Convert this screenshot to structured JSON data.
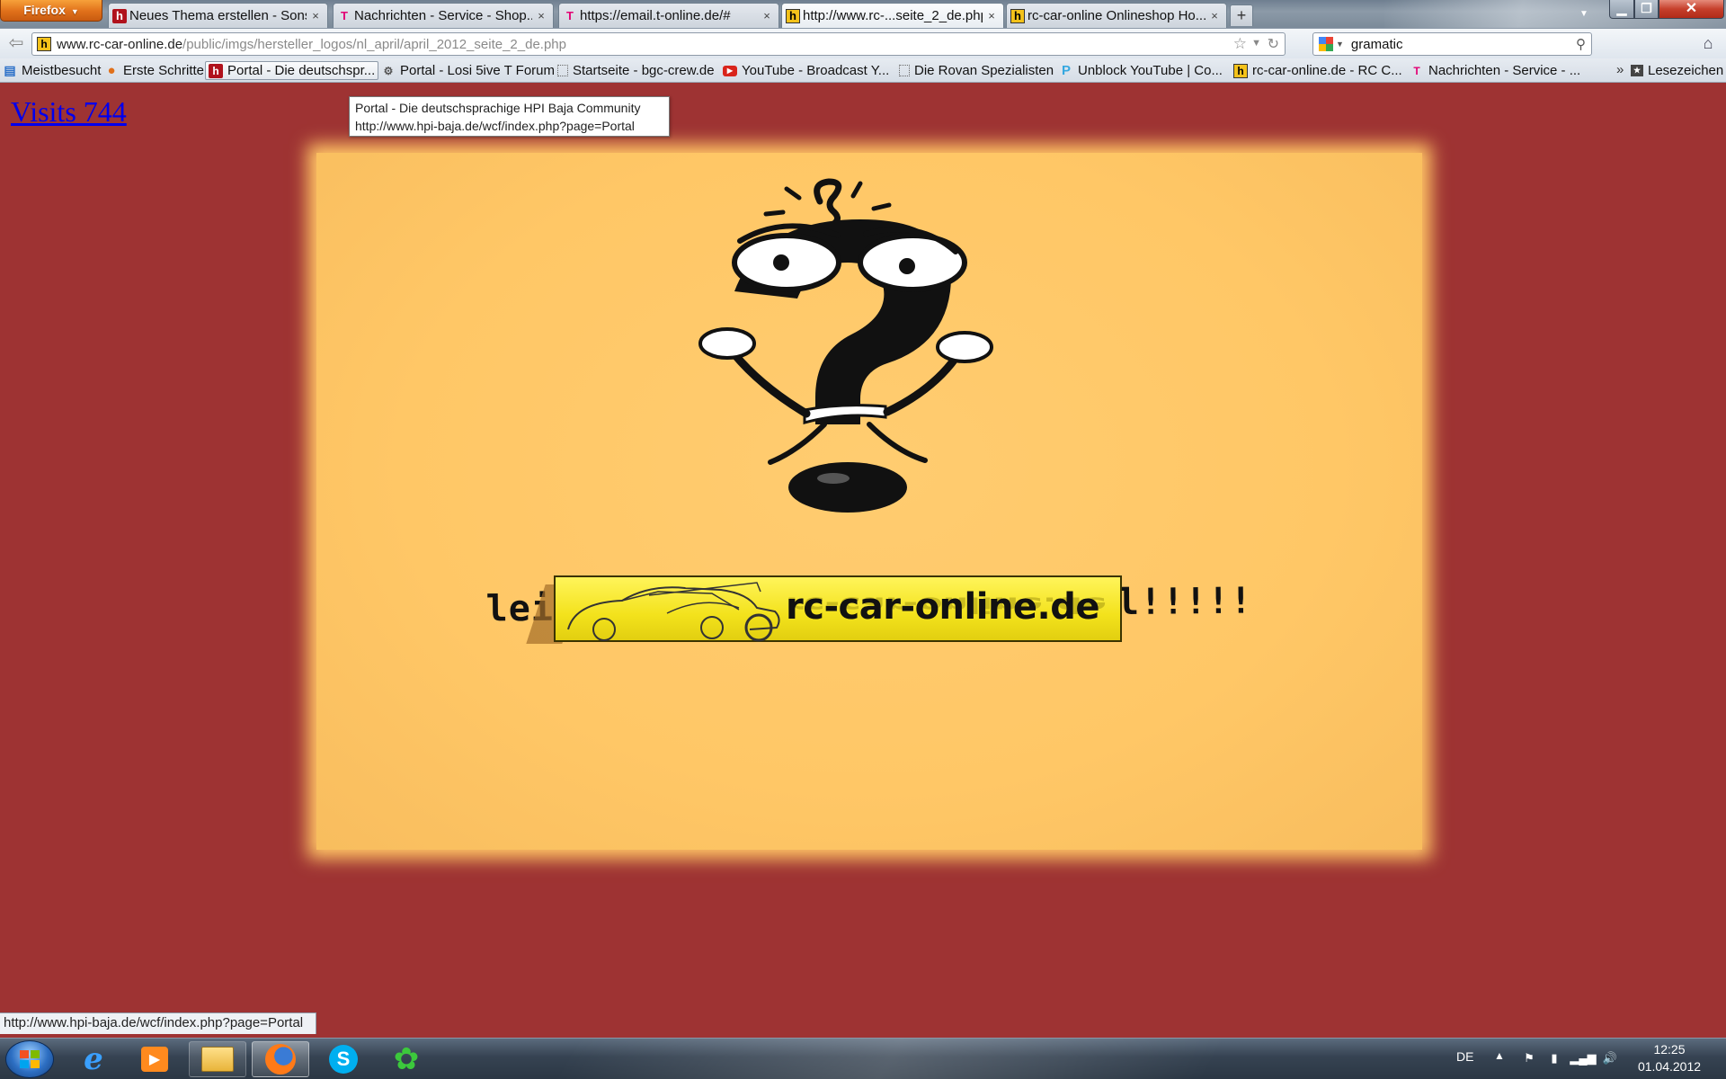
{
  "browser": {
    "menu_button": "Firefox",
    "tabs": [
      {
        "title": "Neues Thema erstellen - Sons...",
        "icon": "hpi-baja-icon"
      },
      {
        "title": "Nachrichten - Service - Shop...",
        "icon": "telekom-icon"
      },
      {
        "title": "https://email.t-online.de/#",
        "icon": "telekom-icon"
      },
      {
        "title": "http://www.rc-...seite_2_de.php",
        "icon": "rc-car-online-icon",
        "active": true
      },
      {
        "title": "rc-car-online Onlineshop Ho...",
        "icon": "rc-car-online-icon"
      }
    ],
    "new_tab": "+",
    "url_domain": "www.rc-car-online.de",
    "url_path": "/public/imgs/hersteller_logos/nl_april/april_2012_seite_2_de.php",
    "search_query": "gramatic",
    "bookmarks": [
      {
        "label": "Meistbesucht",
        "icon": "most-visited-icon"
      },
      {
        "label": "Erste Schritte",
        "icon": "firefox-icon"
      },
      {
        "label": "Portal - Die deutschspr...",
        "icon": "hpi-baja-icon",
        "hover": true
      },
      {
        "label": "Portal - Losi 5ive T Forum",
        "icon": "losi-icon"
      },
      {
        "label": "Startseite - bgc-crew.de",
        "icon": "blank-page-icon"
      },
      {
        "label": "YouTube - Broadcast Y...",
        "icon": "youtube-icon"
      },
      {
        "label": "Die Rovan Spezialisten",
        "icon": "blank-page-icon"
      },
      {
        "label": "Unblock YouTube | Co...",
        "icon": "proxy-icon"
      },
      {
        "label": "rc-car-online.de - RC C...",
        "icon": "rc-car-online-icon"
      },
      {
        "label": "Nachrichten - Service - ...",
        "icon": "telekom-icon"
      }
    ],
    "bookmarks_overflow": "»",
    "reading_list": "Lesezeichen"
  },
  "page": {
    "visits": "Visits 744",
    "tooltip_title": "Portal - Die deutschsprachige HPI Baja Community",
    "tooltip_url": "http://www.hpi-baja.de/wcf/index.php?page=Portal",
    "april_text": "leider nur........April April!!!!!",
    "logo_text": "rc-car-online.de",
    "background_color": "#9e3333",
    "image_background": "#ffc766",
    "logo_color": "#f3e21c"
  },
  "status_bar": "http://www.hpi-baja.de/wcf/index.php?page=Portal",
  "taskbar": {
    "apps": [
      "internet-explorer-icon",
      "media-player-icon",
      "explorer-icon",
      "firefox-icon",
      "skype-icon",
      "icq-icon"
    ],
    "language": "DE",
    "time": "12:25",
    "date": "01.04.2012"
  }
}
